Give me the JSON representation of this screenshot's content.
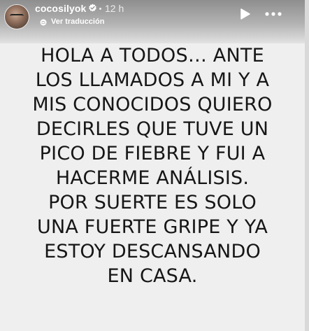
{
  "story": {
    "username": "cocosilyok",
    "time": "12 h",
    "translate_label": "Ver traducción",
    "message_lines": [
      "HOLA A TODOS… ANTE",
      "LOS LLAMADOS A MI Y A",
      "MIS CONOCIDOS QUIERO",
      "DECIRLES QUE TUVE UN",
      "PICO DE FIEBRE Y FUI A",
      "HACERME ANÁLISIS.",
      "POR SUERTE ES SOLO",
      "UNA FUERTE GRIPE Y YA",
      "ESTOY DESCANSANDO",
      "EN CASA."
    ]
  },
  "icons": {
    "verified": "verified-badge-icon",
    "globe": "globe-icon",
    "play": "play-icon",
    "more": "more-horizontal-icon"
  },
  "colors": {
    "background": "#efefef",
    "text": "#161616",
    "header_text": "#ffffff"
  }
}
